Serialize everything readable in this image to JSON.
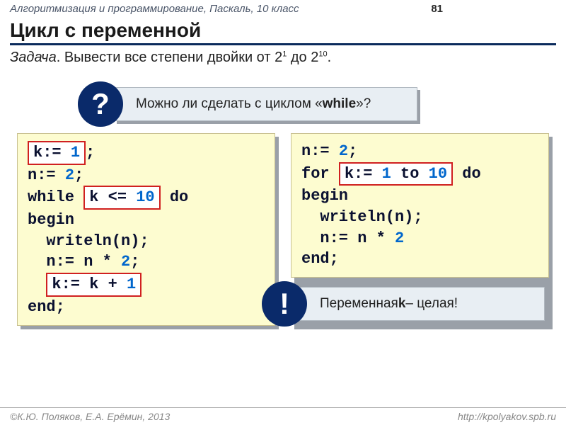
{
  "header": {
    "subject": "Алгоритмизация и программирование, Паскаль, 10 класс",
    "page": "81"
  },
  "title": "Цикл с переменной",
  "task": {
    "label": "Задача",
    "text": ". Вывести все степени двойки от 2",
    "exp1": "1",
    "mid": " до 2",
    "exp2": "10",
    "end": "."
  },
  "callout_q": {
    "badge": "?",
    "text_pre": "Можно ли сделать с циклом «",
    "kw": "while",
    "text_post": "»?"
  },
  "callout_e": {
    "badge": "!",
    "text_pre": "Переменная ",
    "var": "k",
    "text_post": " – целая!"
  },
  "code_left": {
    "l1": {
      "box": {
        "a": "k:= ",
        "n": "1"
      },
      "tail": ";"
    },
    "l2": {
      "a": "n:= ",
      "n": "2",
      "b": ";"
    },
    "l3": {
      "a": "while ",
      "box": {
        "a": "k <= ",
        "n": "10"
      },
      "tail": "  do"
    },
    "l4": "begin",
    "l5": "  writeln(n);",
    "l6": {
      "a": "  n:= n * ",
      "n": "2",
      "b": ";"
    },
    "l7": {
      "pre": "  ",
      "box": {
        "a": "k:= k + ",
        "n": "1"
      }
    },
    "l8": "end;"
  },
  "code_right": {
    "l1": {
      "a": "n:= ",
      "n": "2",
      "b": ";"
    },
    "l2": {
      "a": "for ",
      "box": {
        "a": "k:= ",
        "n1": "1",
        "mid": " to ",
        "n2": "10"
      },
      "tail": " do"
    },
    "l3": "begin",
    "l4": "  writeln(n);",
    "l5": {
      "a": "  n:= n * ",
      "n": "2"
    },
    "l6": "end;"
  },
  "footer": {
    "authors": "К.Ю. Поляков, Е.А. Ерёмин, 2013",
    "url": "http://kpolyakov.spb.ru"
  }
}
